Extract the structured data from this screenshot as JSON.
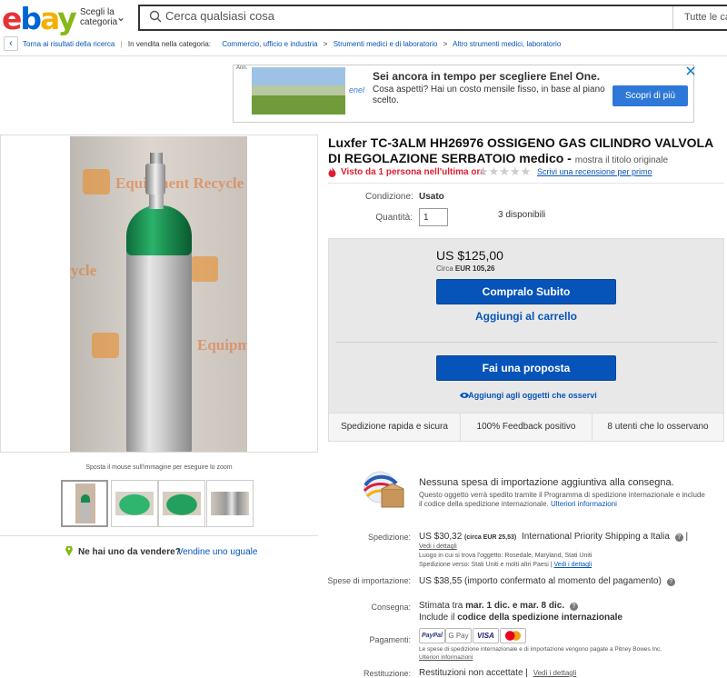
{
  "header": {
    "logo_letters": [
      "e",
      "b",
      "a",
      "y"
    ],
    "category_selector": "Scegli la categoria",
    "search_placeholder": "Cerca qualsiasi cosa",
    "category_dropdown": "Tutte le categorie"
  },
  "breadcrumb": {
    "back": "Torna ai risultati della ricerca",
    "in_category": "In vendita nella categoria:",
    "items": [
      "Commercio, ufficio e industria",
      "Strumenti medici e di laboratorio",
      "Altro strumenti medici, laboratorio"
    ],
    "separator": ">"
  },
  "ad": {
    "label": "Ann.",
    "brand": "enel",
    "title": "Sei ancora in tempo per scegliere Enel One.",
    "body": "Cosa aspetti? Hai un costo mensile fisso, in base al piano scelto.",
    "cta": "Scopri di più"
  },
  "gallery": {
    "watermark": "Equipment Recycle",
    "zoom_hint": "Sposta il mouse sull'immagine per eseguire lo zoom",
    "thumbnail_count": 4
  },
  "seller_prompt": {
    "question": "Ne hai uno da vendere?",
    "link": "Vendine uno uguale"
  },
  "listing": {
    "title": "Luxfer TC-3ALM HH26976 OSSIGENO GAS CILINDRO VALVOLA DI REGOLAZIONE SERBATOIO medico",
    "title_suffix": " - ",
    "original_title_link": "mostra il titolo originale",
    "views": "Visto da 1 persona nell'ultima ora",
    "stars": "★★★★★",
    "review_link": "Scrivi una recensione per primo",
    "condition_label": "Condizione:",
    "condition_value": "Usato",
    "quantity_label": "Quantità:",
    "quantity_value": "1",
    "available": "3 disponibili"
  },
  "buy": {
    "price": "US $125,00",
    "approx_prefix": "Circa ",
    "approx_value": "EUR 105,26",
    "buy_now": "Compralo Subito",
    "add_to_cart": "Aggiungi al carrello",
    "make_offer": "Fai una proposta",
    "watch": "Aggiungi agli oggetti che osservi",
    "stats": [
      "Spedizione rapida e sicura",
      "100% Feedback positivo",
      "8 utenti che lo osservano"
    ]
  },
  "import": {
    "title": "Nessuna spesa di importazione aggiuntiva alla consegna.",
    "body": "Questo oggetto verrà spedito tramite il Programma di spedizione internazionale e include il codice della spedizione internazionale.",
    "link": "Ulteriori informazioni"
  },
  "details": {
    "shipping_label": "Spedizione:",
    "shipping_price": "US $30,32",
    "shipping_approx": "(circa EUR 25,53)",
    "shipping_service": "International Priority Shipping a Italia",
    "details_link": "Vedi i dettagli",
    "location": "Luogo in cui si trova l'oggetto:  Rosedale, Maryland, Stati Uniti",
    "ships_to": "Spedizione verso:  Stati Uniti e molti altri Paesi |",
    "import_label": "Spese di importazione:",
    "import_value": "US $38,55",
    "import_note": "(importo confermato al momento del pagamento)",
    "delivery_label": "Consegna:",
    "delivery_prefix": "Stimata tra ",
    "delivery_dates": "mar. 1 dic. e mar. 8 dic.",
    "delivery_code_prefix": "Include il ",
    "delivery_code": "codice della spedizione internazionale",
    "payments_label": "Pagamenti:",
    "payments": [
      "PayPal",
      "G Pay",
      "VISA",
      "MC"
    ],
    "payments_note": "Le spese di spedizione internazionale e di importazione vengono pagate a Pitney Bowes Inc.",
    "payments_link": "Ulteriori informazioni",
    "returns_label": "Restituzione:",
    "returns_value": "Restituzioni non accettate",
    "returns_link": "Vedi i dettagli"
  },
  "colors": {
    "ebay_red": "#e53238",
    "ebay_blue": "#0064d2",
    "ebay_yellow": "#f5af02",
    "ebay_green": "#86b817",
    "button_blue": "#0654ba",
    "views_red": "#dd1e31"
  }
}
